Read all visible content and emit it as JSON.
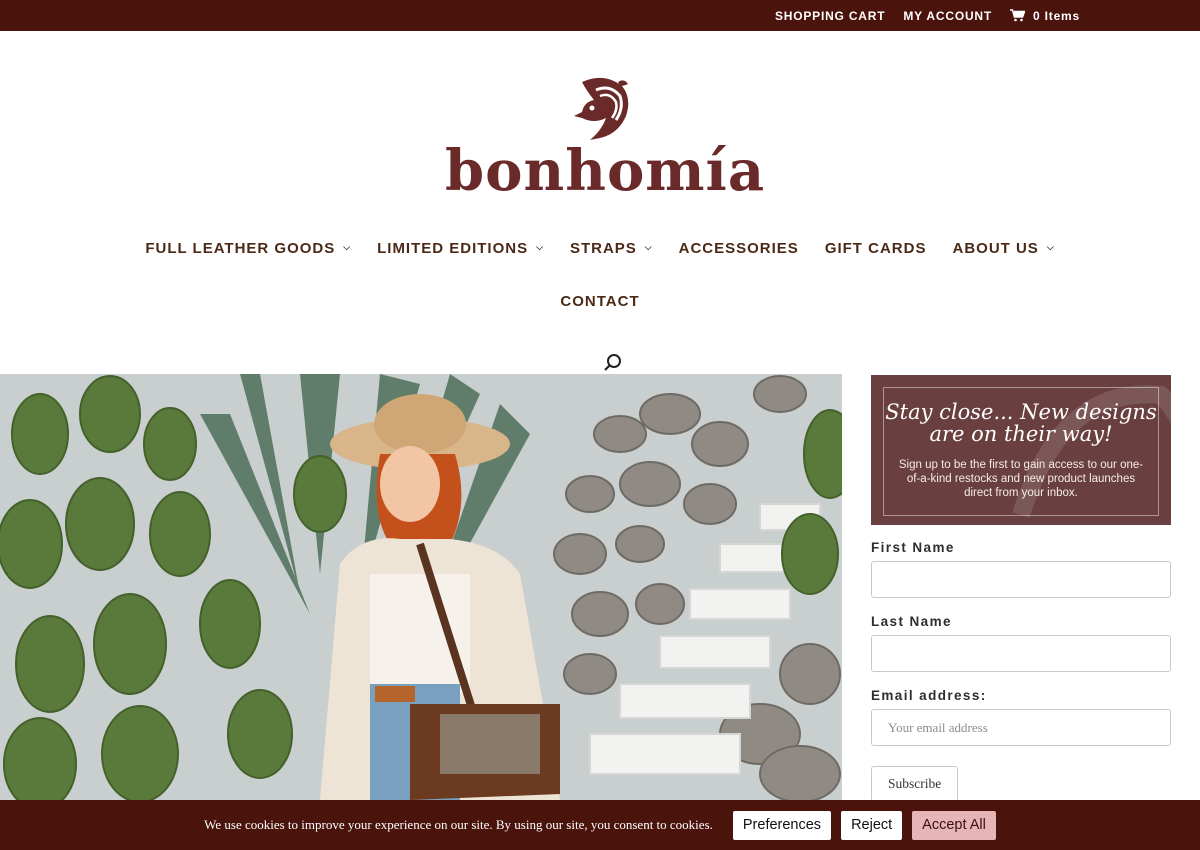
{
  "topbar": {
    "shopping_cart": "SHOPPING CART",
    "my_account": "MY ACCOUNT",
    "cart_count": "0 Items",
    "bg_color": "#4a130c"
  },
  "brand": {
    "name": "bonhomía",
    "color": "#6b2a2a",
    "logo_icon": "bird-icon"
  },
  "nav": {
    "items": [
      {
        "label": "FULL LEATHER GOODS",
        "has_submenu": true
      },
      {
        "label": "LIMITED EDITIONS",
        "has_submenu": true
      },
      {
        "label": "STRAPS",
        "has_submenu": true
      },
      {
        "label": "ACCESSORIES",
        "has_submenu": false
      },
      {
        "label": "GIFT CARDS",
        "has_submenu": false
      },
      {
        "label": "ABOUT US",
        "has_submenu": true
      }
    ],
    "contact": "CONTACT",
    "search_icon": "search-icon"
  },
  "promo": {
    "headline": "Stay close... New designs are on their way!",
    "body": "Sign up to be the first to gain access to our one-of-a-kind restocks and new product launches direct from your inbox.",
    "bg_color": "#6a3f3f"
  },
  "form": {
    "first_name_label": "First Name",
    "last_name_label": "Last Name",
    "email_label": "Email address:",
    "first_name_value": "",
    "last_name_value": "",
    "email_placeholder": "Your email address",
    "subscribe_label": "Subscribe"
  },
  "cookie": {
    "message": "We use cookies to improve your experience on our site. By using our site, you consent to cookies.",
    "preferences": "Preferences",
    "reject": "Reject",
    "accept_all": "Accept All",
    "accept_color": "#e6b5b5"
  }
}
